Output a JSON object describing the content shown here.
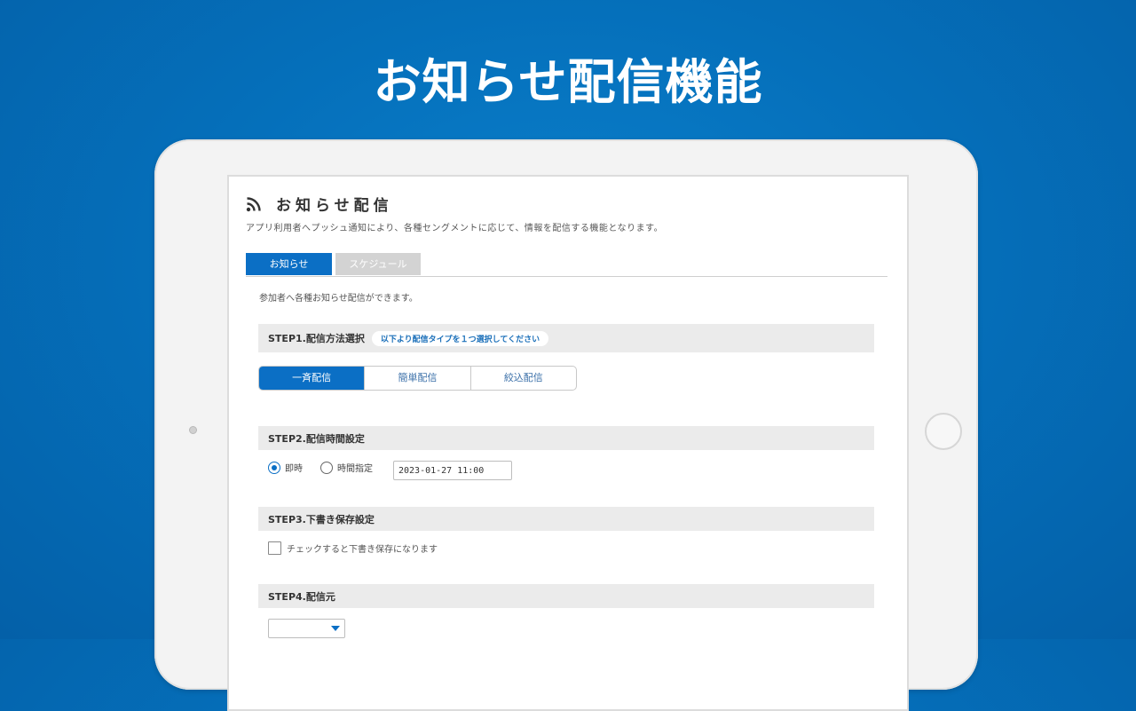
{
  "hero": {
    "title": "お知らせ配信機能"
  },
  "page": {
    "icon": "rss-icon",
    "title": "お知らせ配信",
    "description": "アプリ利用者へプッシュ通知により、各種セングメントに応じて、情報を配信する機能となります。"
  },
  "tabs": [
    {
      "label": "お知らせ",
      "active": true
    },
    {
      "label": "スケジュール",
      "active": false
    }
  ],
  "intro": "参加者へ各種お知らせ配信ができます。",
  "step1": {
    "title": "STEP1.配信方法選択",
    "hint": "以下より配信タイプを１つ選択してください",
    "options": [
      {
        "label": "一斉配信",
        "selected": true
      },
      {
        "label": "簡単配信",
        "selected": false
      },
      {
        "label": "絞込配信",
        "selected": false
      }
    ]
  },
  "step2": {
    "title": "STEP2.配信時間設定",
    "radio_immediate": "即時",
    "radio_scheduled": "時間指定",
    "selected": "即時",
    "datetime_value": "2023-01-27 11:00"
  },
  "step3": {
    "title": "STEP3.下書き保存設定",
    "checkbox_label": "チェックすると下書き保存になります",
    "checked": false
  },
  "step4": {
    "title": "STEP4.配信元",
    "select_value": ""
  },
  "colors": {
    "background": "#0570bb",
    "accent": "#0b6fc5",
    "step_bar": "#ebebeb",
    "inactive_tab": "#d3d3d3"
  }
}
